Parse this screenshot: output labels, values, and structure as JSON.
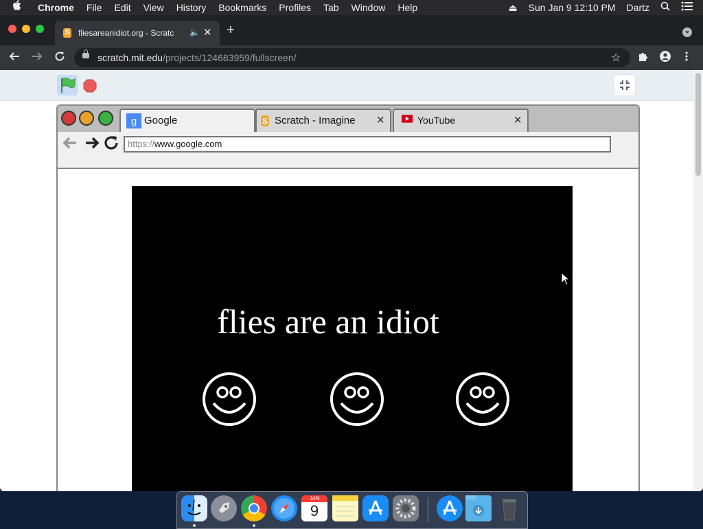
{
  "menubar": {
    "apple": "",
    "app_name": "Chrome",
    "menus": [
      "File",
      "Edit",
      "View",
      "History",
      "Bookmarks",
      "Profiles",
      "Tab",
      "Window",
      "Help"
    ],
    "clock": "Sun Jan 9  12:10 PM",
    "user": "Dartz"
  },
  "browser": {
    "tab_title": "fliesareanidiot.org - Scratc",
    "tab_favicon_letter": "S",
    "url_host": "scratch.mit.edu",
    "url_path": "/projects/124683959/fullscreen/"
  },
  "stage": {
    "tabs": [
      {
        "label": "Google",
        "icon": "google-g-icon"
      },
      {
        "label": "Scratch - Imagine",
        "icon": "scratch-s-icon"
      },
      {
        "label": "YouTube",
        "icon": "youtube-play-icon"
      }
    ],
    "address_protocol": "https://",
    "address_domain": "www.google.com",
    "headline": "flies are an idiot",
    "smiley_count": 3
  },
  "dock": {
    "apps": [
      "Finder",
      "Launchpad",
      "Google Chrome",
      "Safari",
      "Calendar",
      "Notes",
      "App Store",
      "System Preferences",
      "App Store",
      "Downloads",
      "Trash"
    ],
    "calendar_month": "JAN",
    "calendar_day": "9"
  },
  "colors": {
    "menubar_bg": "#2a2a2c",
    "tabstrip_bg": "#202124",
    "toolbar_bg": "#35363a",
    "scratch_bar_bg": "#e9eef3",
    "stage_black": "#000000",
    "flag_green": "#4cbf56",
    "stop_red": "#ec5959"
  }
}
